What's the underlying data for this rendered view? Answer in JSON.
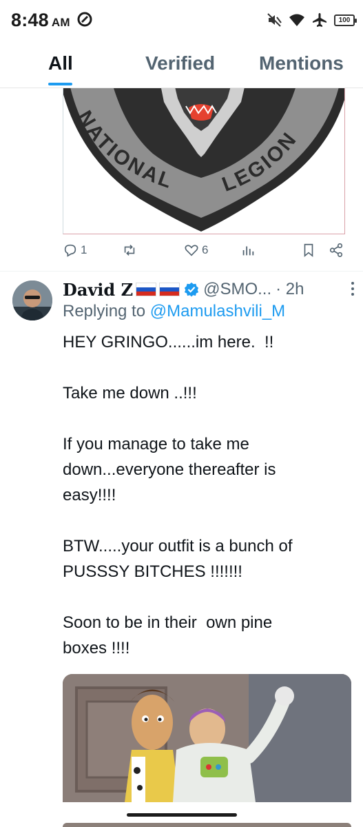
{
  "status_bar": {
    "time": "8:48",
    "ampm": "AM",
    "battery": "100",
    "icons": [
      "dnd-icon",
      "mute-icon",
      "wifi-icon",
      "airplane-icon",
      "battery-icon"
    ]
  },
  "tabs": [
    {
      "label": "All",
      "active": true
    },
    {
      "label": "Verified",
      "active": false
    },
    {
      "label": "Mentions",
      "active": false
    }
  ],
  "previous_tweet": {
    "media_text_left": "NATIONAL",
    "media_text_right": "LEGION",
    "actions": {
      "reply_count": "1",
      "retweet_count": "",
      "like_count": "6"
    }
  },
  "tweet": {
    "author_name": "David Z",
    "flags": [
      "russia-flag",
      "russia-flag"
    ],
    "handle": "@SMO...",
    "time": "· 2h",
    "replying_prefix": "Replying to",
    "replying_to": "@Mamulashvili_M",
    "lines": [
      "HEY GRINGO......im here.  !!",
      "",
      "Take me down ..!!!",
      "",
      "If you manage to take me",
      "down...everyone thereafter is",
      "easy!!!!",
      "",
      "BTW.....your outfit is a bunch of",
      "PUSSSY BITCHES !!!!!!!",
      "",
      "Soon to be in their  own pine",
      "boxes !!!!"
    ]
  },
  "colors": {
    "accent": "#1d9bf0",
    "secondary_text": "#536471",
    "primary_text": "#0f1419"
  }
}
